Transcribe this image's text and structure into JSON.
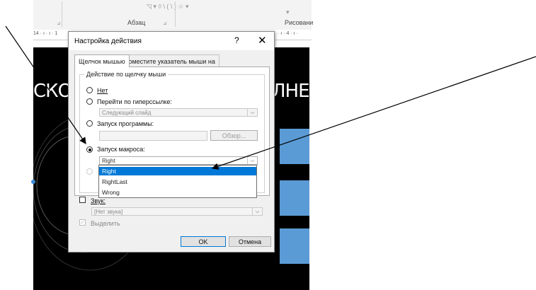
{
  "ribbon": {
    "group_paragraph": "Абзац",
    "group_drawing": "Рисовани",
    "ghost_symbols": "◹ ▾  ◊ \\ ( \\ ) ☆ ▾"
  },
  "ruler": {
    "left": "14 · ı · ı · 1",
    "right": "· ı · 4 · ı ·"
  },
  "slide": {
    "title_left": "СКО",
    "title_right": "ЛНЕ"
  },
  "dialog": {
    "title": "Настройка действия",
    "help": "?",
    "close": "✕",
    "tabs": [
      {
        "label": "Щелчок мышью",
        "active": true
      },
      {
        "label": "Поместите указатель мыши на",
        "active": false
      }
    ],
    "group_label": "Действие по щелчку мыши",
    "options": {
      "none": "Нет",
      "hyperlink": "Перейти по гиперссылке:",
      "hyperlink_value": "Следующий слайд",
      "run_program": "Запуск программы:",
      "browse": "Обзор...",
      "run_macro": "Запуск макроса:",
      "macro_value": "Right"
    },
    "macro_list": [
      {
        "label": "Right",
        "selected": true
      },
      {
        "label": "RightLast",
        "selected": false
      },
      {
        "label": "Wrong",
        "selected": false
      }
    ],
    "sound_label": "Звук:",
    "sound_value": "[Нет звука]",
    "highlight_label": "Выделить",
    "ok": "OK",
    "cancel": "Отмена",
    "dropdown_arrow": "⌵"
  }
}
